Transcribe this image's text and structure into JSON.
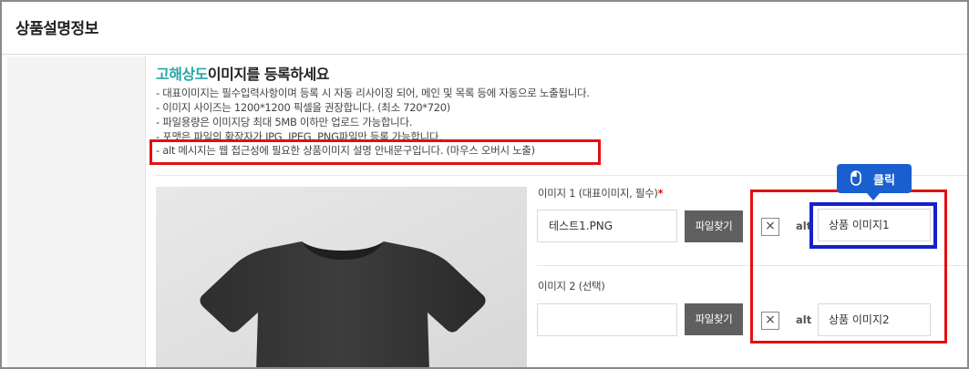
{
  "page": {
    "title": "상품설명정보"
  },
  "section": {
    "brand_name": "고해상도",
    "heading_rest": "이미지를 등록하세요",
    "guides": [
      "- 대표이미지는 필수입력사항이며 등록 시 자동 리사이징 되어, 메인 및 목록 등에 자동으로 노출됩니다.",
      "- 이미지 사이즈는 1200*1200 픽셀을 권장합니다. (최소 720*720)",
      "- 파일용량은 이미지당 최대 5MB 이하만 업로드 가능합니다.",
      "- 포맷은 파일의 확장자가 JPG, JPEG, PNG파일만 등록 가능합니다.",
      "- alt 메시지는 웹 접근성에 필요한 상품이미지 설명 안내문구입니다. (마우스 오버시 노출)"
    ]
  },
  "images": [
    {
      "label": "이미지 1 (대표이미지, 필수)",
      "required_mark": "*",
      "file_name": "테스트1.PNG",
      "find_button": "파일찾기",
      "remove_icon": "×",
      "alt_label": "alt",
      "alt_value": "상품 이미지1"
    },
    {
      "label": "이미지 2 (선택)",
      "file_name": "",
      "find_button": "파일찾기",
      "remove_icon": "×",
      "alt_label": "alt",
      "alt_value": "상품 이미지2"
    }
  ],
  "tooltip": {
    "icon": "mouse-icon",
    "label": "클릭"
  },
  "colors": {
    "brand": "#27a7a2",
    "highlight": "#e31010",
    "focus": "#1521cc",
    "tooltip": "#1a5fd0",
    "button": "#5f5f5f"
  }
}
